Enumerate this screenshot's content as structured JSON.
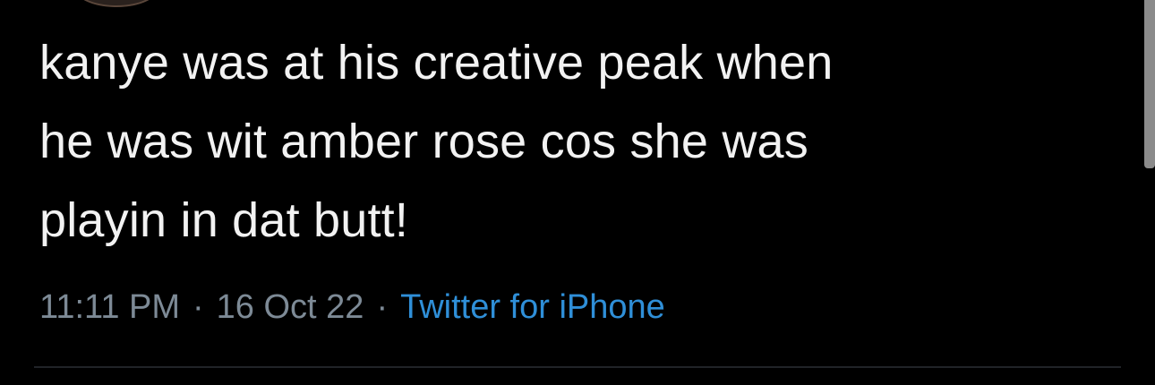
{
  "tweet": {
    "text_lines": [
      "kanye was at his creative peak when",
      "he was wit amber rose cos she was",
      "playin in dat butt!"
    ],
    "time": "11:11 PM",
    "separator": "·",
    "date": "16 Oct 22",
    "source": "Twitter for iPhone"
  },
  "colors": {
    "background": "#000000",
    "text": "#f2f2f2",
    "meta": "#7d8a96",
    "link": "#2f8fd8"
  },
  "icons": {
    "avatar": "avatar-image"
  }
}
